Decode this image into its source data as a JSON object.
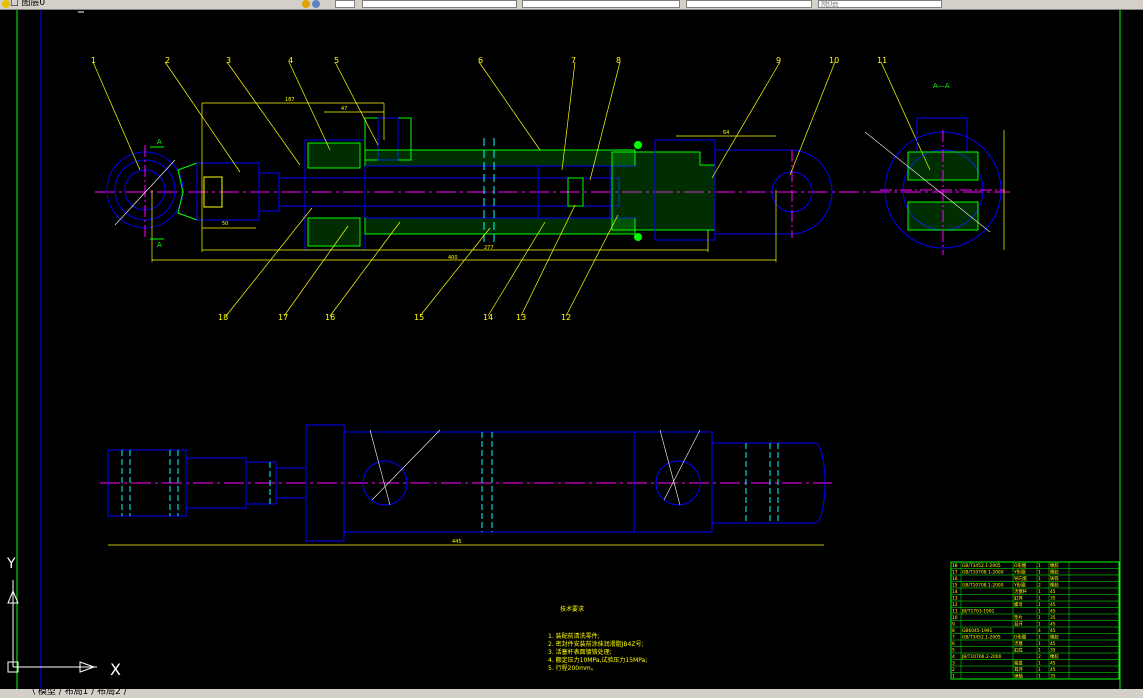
{
  "toolbar": {
    "layer_text": "□ 图层0",
    "style1": "",
    "style2": "",
    "style3": "",
    "style4": "随层"
  },
  "drawing": {
    "section_label": "A—A",
    "view_marker_a": "A",
    "part_numbers_top": [
      "1",
      "2",
      "3",
      "4",
      "5",
      "6",
      "7",
      "8",
      "9",
      "10",
      "11"
    ],
    "part_numbers_bottom": [
      "18",
      "17",
      "16",
      "15",
      "14",
      "13",
      "12"
    ],
    "dim_overall": "400",
    "dim_stroke": "277",
    "dim_rod": "50",
    "dim_top1": "187",
    "dim_top2": "47",
    "dim_total_bottom": "445",
    "dim_side": "64",
    "notes_title": "技术要求",
    "notes": [
      "1. 装配前清洗零件;",
      "2. 密封件安装前涂抹润滑脂JB4Z号;",
      "3. 活塞杆表面镀铬处理;",
      "4. 额定压力10MPa,试验压力15MPa;",
      "5. 行程200mm。"
    ]
  },
  "bom": {
    "rows": [
      [
        "18",
        "GB/T3452.1-2005",
        "O形圈",
        "1",
        "橡胶"
      ],
      [
        "17",
        "GB/T10708.1-2000",
        "Y形圈",
        "1",
        "橡胶"
      ],
      [
        "16",
        "",
        "导向套",
        "1",
        "铸铁"
      ],
      [
        "15",
        "GB/T10708.1-2000",
        "Y形圈",
        "2",
        "橡胶"
      ],
      [
        "14",
        "",
        "活塞杆",
        "1",
        "45"
      ],
      [
        "13",
        "",
        "缸体",
        "1",
        "35"
      ],
      [
        "12",
        "",
        "螺母",
        "1",
        "45"
      ],
      [
        "11",
        "JB/T1703-1991",
        "",
        "1",
        "45"
      ],
      [
        "10",
        "",
        "垫片",
        "1",
        "35"
      ],
      [
        "9",
        "",
        "耳环",
        "1",
        "45"
      ],
      [
        "8",
        "GB6045-1991",
        "",
        "4",
        "45"
      ],
      [
        "7",
        "GB/T3452.1-2005",
        "O形圈",
        "1",
        "橡胶"
      ],
      [
        "6",
        "",
        "活塞",
        "1",
        "45"
      ],
      [
        "5",
        "",
        "缸底",
        "1",
        "35"
      ],
      [
        "4",
        "JB/T10706.2-2000",
        "",
        "2",
        "橡胶"
      ],
      [
        "3",
        "",
        "端盖",
        "1",
        "45"
      ],
      [
        "2",
        "",
        "耳环",
        "1",
        "45"
      ],
      [
        "1",
        "",
        "销轴",
        "1",
        "35"
      ]
    ]
  },
  "ucs": {
    "x_label": "X",
    "y_label": "Y"
  },
  "tabs": {
    "text": "\\ 模型 / 布局1 / 布局2 /"
  },
  "colors": {
    "background": "#000000",
    "geometry": "#0000ff",
    "dimension": "#ffff00",
    "hatch": "#00ff00",
    "centerline": "#ff00ff",
    "hidden": "#00ffff",
    "frame": "#00ff00",
    "note": "#ffffff"
  }
}
